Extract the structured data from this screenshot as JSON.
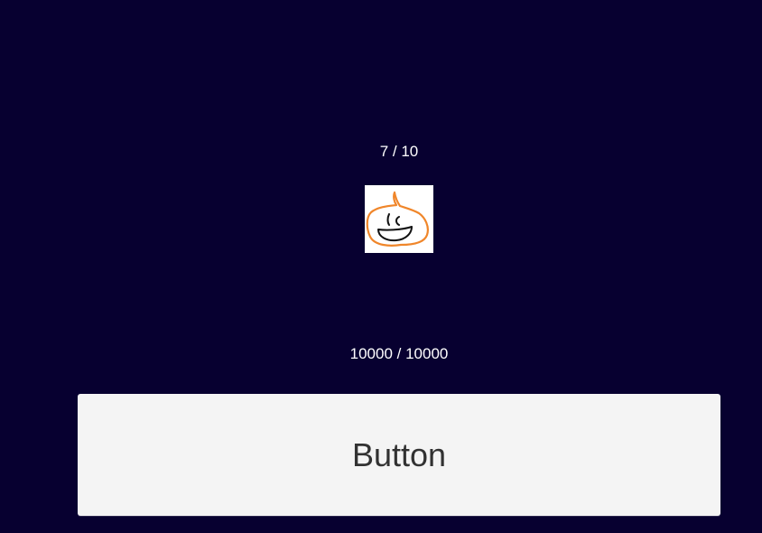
{
  "colors": {
    "background": "#070030",
    "text": "#ffffff",
    "button_background": "#f4f4f4",
    "button_text": "#323232",
    "sprite_outline": "#f0862a"
  },
  "stage": {
    "counter": "7 / 10"
  },
  "sprite": {
    "icon": "orange-slime-face-icon"
  },
  "resource": {
    "counter": "10000 / 10000"
  },
  "action_button": {
    "label": "Button"
  }
}
